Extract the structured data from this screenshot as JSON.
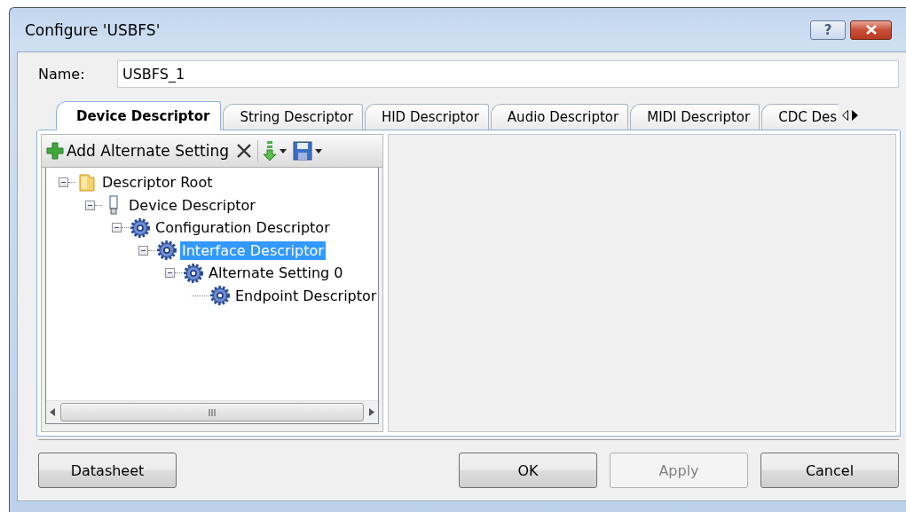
{
  "window": {
    "title": "Configure 'USBFS'",
    "help_button": "?"
  },
  "name_field": {
    "label": "Name:",
    "value": "USBFS_1"
  },
  "tabs": [
    {
      "label": "Device Descriptor",
      "selected": true
    },
    {
      "label": "String Descriptor",
      "selected": false
    },
    {
      "label": "HID Descriptor",
      "selected": false
    },
    {
      "label": "Audio Descriptor",
      "selected": false
    },
    {
      "label": "MIDI Descriptor",
      "selected": false
    },
    {
      "label": "CDC Des",
      "selected": false
    }
  ],
  "toolbar": {
    "add_button": "Add Alternate Setting"
  },
  "tree": [
    {
      "label": "Descriptor Root",
      "kind": "folder",
      "expanded": true,
      "selected": false,
      "children": [
        {
          "label": "Device Descriptor",
          "kind": "device",
          "expanded": true,
          "selected": false,
          "children": [
            {
              "label": "Configuration Descriptor",
              "kind": "gear",
              "expanded": true,
              "selected": false,
              "children": [
                {
                  "label": "Interface Descriptor",
                  "kind": "gear",
                  "expanded": true,
                  "selected": true,
                  "children": [
                    {
                      "label": "Alternate Setting 0",
                      "kind": "gear",
                      "expanded": true,
                      "selected": false,
                      "children": [
                        {
                          "label": "Endpoint Descriptor",
                          "kind": "gear",
                          "selected": false
                        }
                      ]
                    }
                  ]
                }
              ]
            }
          ]
        }
      ]
    }
  ],
  "buttons": [
    {
      "label": "Datasheet",
      "disabled": false
    },
    {
      "label": "OK",
      "disabled": false
    },
    {
      "label": "Apply",
      "disabled": true
    },
    {
      "label": "Cancel",
      "disabled": false
    }
  ]
}
